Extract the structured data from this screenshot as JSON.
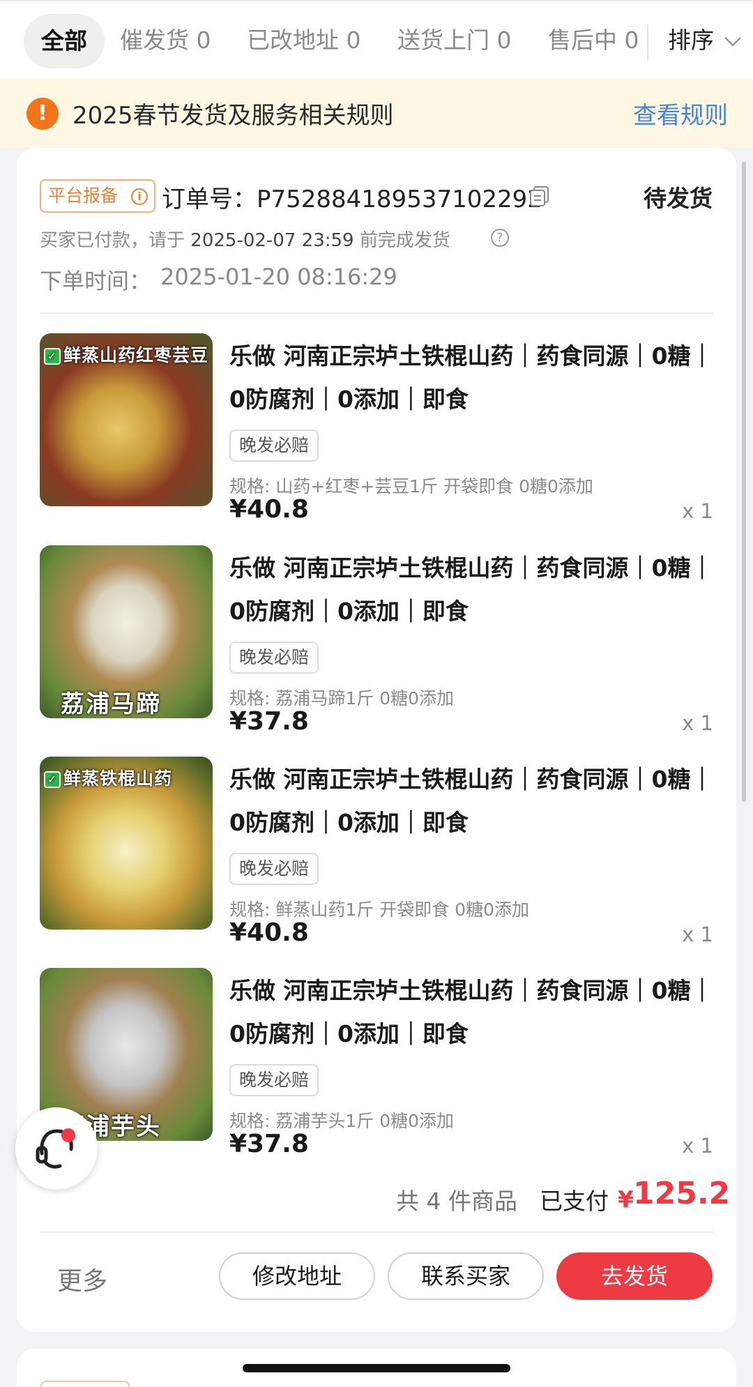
{
  "tabs": {
    "all": "全部",
    "urge": "催发货 0",
    "address_changed": "已改地址 0",
    "home_delivery": "送货上门 0",
    "after_sales": "售后中 0",
    "sort": "排序"
  },
  "notice": {
    "icon": "!",
    "text": "2025春节发货及服务相关规则",
    "link": "查看规则"
  },
  "order": {
    "platform_badge": "平台报备",
    "badge_info_icon": "i",
    "order_number": "订单号：P752884189537102292",
    "status": "待发货",
    "paid_note_prefix": "买家已付款，请于",
    "deadline": "2025-02-07 23:59",
    "paid_note_suffix": "前完成发货",
    "help_icon": "?",
    "order_time_label": "下单时间：",
    "order_time": "2025-01-20 08:16:29",
    "items": [
      {
        "thumb_label": "鲜蒸山药红枣芸豆",
        "title": "乐做 河南正宗垆土铁棍山药｜药食同源｜0糖｜0防腐剂｜0添加｜即食",
        "tag": "晚发必赔",
        "spec": "规格: 山药+红枣+芸豆1斤 开袋即食 0糖0添加",
        "price": "¥40.8",
        "qty": "x 1"
      },
      {
        "thumb_label": "荔浦马蹄",
        "title": "乐做 河南正宗垆土铁棍山药｜药食同源｜0糖｜0防腐剂｜0添加｜即食",
        "tag": "晚发必赔",
        "spec": "规格: 荔浦马蹄1斤 0糖0添加",
        "price": "¥37.8",
        "qty": "x 1"
      },
      {
        "thumb_label": "鲜蒸铁棍山药",
        "title": "乐做 河南正宗垆土铁棍山药｜药食同源｜0糖｜0防腐剂｜0添加｜即食",
        "tag": "晚发必赔",
        "spec": "规格: 鲜蒸山药1斤 开袋即食 0糖0添加",
        "price": "¥40.8",
        "qty": "x 1"
      },
      {
        "thumb_label": "荔浦芋头",
        "title": "乐做 河南正宗垆土铁棍山药｜药食同源｜0糖｜0防腐剂｜0添加｜即食",
        "tag": "晚发必赔",
        "spec": "规格: 荔浦芋头1斤 0糖0添加",
        "price": "¥37.8",
        "qty": "x 1"
      }
    ],
    "summary_count": "共 4 件商品",
    "summary_paid_label": "已支付",
    "currency": "¥",
    "total": "125.2"
  },
  "actions": {
    "more": "更多",
    "modify_address": "修改地址",
    "contact_buyer": "联系买家",
    "ship": "去发货"
  },
  "icons": {
    "copy": "copy-icon",
    "sort_chevron": "chevron-down-icon",
    "service": "customer-service-icon"
  },
  "colors": {
    "accent_red": "#ee3a43",
    "notice_bg": "#fdf7e4",
    "notice_icon": "#f2751b",
    "link_blue": "#4a84d8",
    "badge_orange": "#e8803a"
  }
}
